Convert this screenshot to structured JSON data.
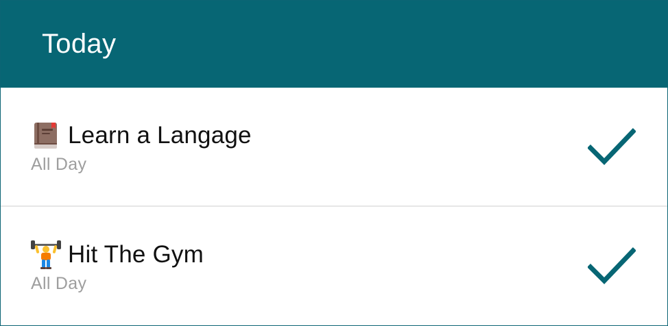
{
  "header": {
    "title": "Today"
  },
  "tasks": [
    {
      "title": "Learn a Langage",
      "subtitle": "All Day",
      "icon": "book-icon",
      "done_icon": "checkmark-icon"
    },
    {
      "title": "Hit The Gym",
      "subtitle": "All Day",
      "icon": "weightlifter-icon",
      "done_icon": "checkmark-icon"
    }
  ],
  "colors": {
    "app_bar": "#076674",
    "accent_check": "#076674",
    "subtitle_text": "#9e9e9e",
    "divider": "#e6e6e6"
  }
}
